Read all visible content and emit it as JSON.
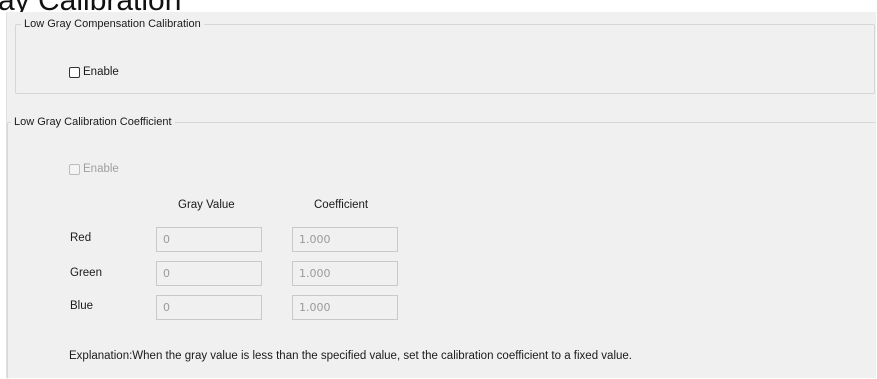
{
  "page": {
    "heading": "ay Calibration"
  },
  "compensation": {
    "title": "Low Gray Compensation Calibration",
    "enable_label": "Enable",
    "enabled": false
  },
  "coefficient": {
    "title": "Low Gray Calibration Coefficient",
    "enable_label": "Enable",
    "enabled": false,
    "disabled": true,
    "gray_value_header": "Gray Value",
    "coefficient_header": "Coefficient",
    "rows": [
      {
        "label": "Red",
        "gray_value": "0",
        "coefficient": "1.000"
      },
      {
        "label": "Green",
        "gray_value": "0",
        "coefficient": "1.000"
      },
      {
        "label": "Blue",
        "gray_value": "0",
        "coefficient": "1.000"
      }
    ],
    "explanation": "Explanation:When the gray value is less than the specified value, set the calibration coefficient to a fixed value."
  }
}
